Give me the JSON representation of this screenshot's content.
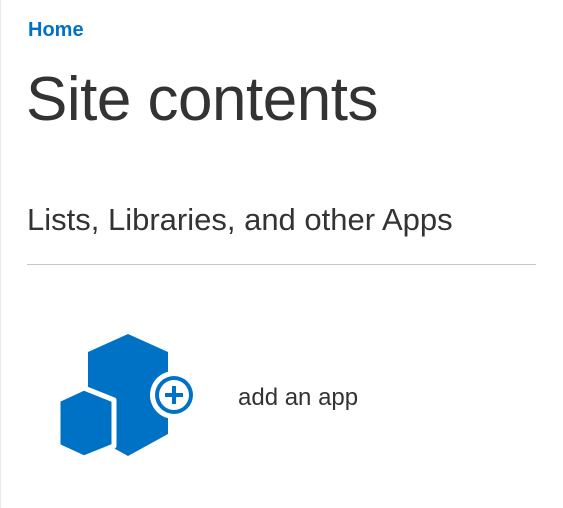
{
  "breadcrumb": {
    "home_label": "Home"
  },
  "page": {
    "title": "Site contents"
  },
  "section": {
    "heading": "Lists, Libraries, and other Apps"
  },
  "add_app": {
    "label": "add an app",
    "icon": "add-app-icon"
  },
  "colors": {
    "link": "#0072c6",
    "icon_blue": "#0072c6",
    "text": "#333333",
    "divider": "#c6c6c6"
  }
}
